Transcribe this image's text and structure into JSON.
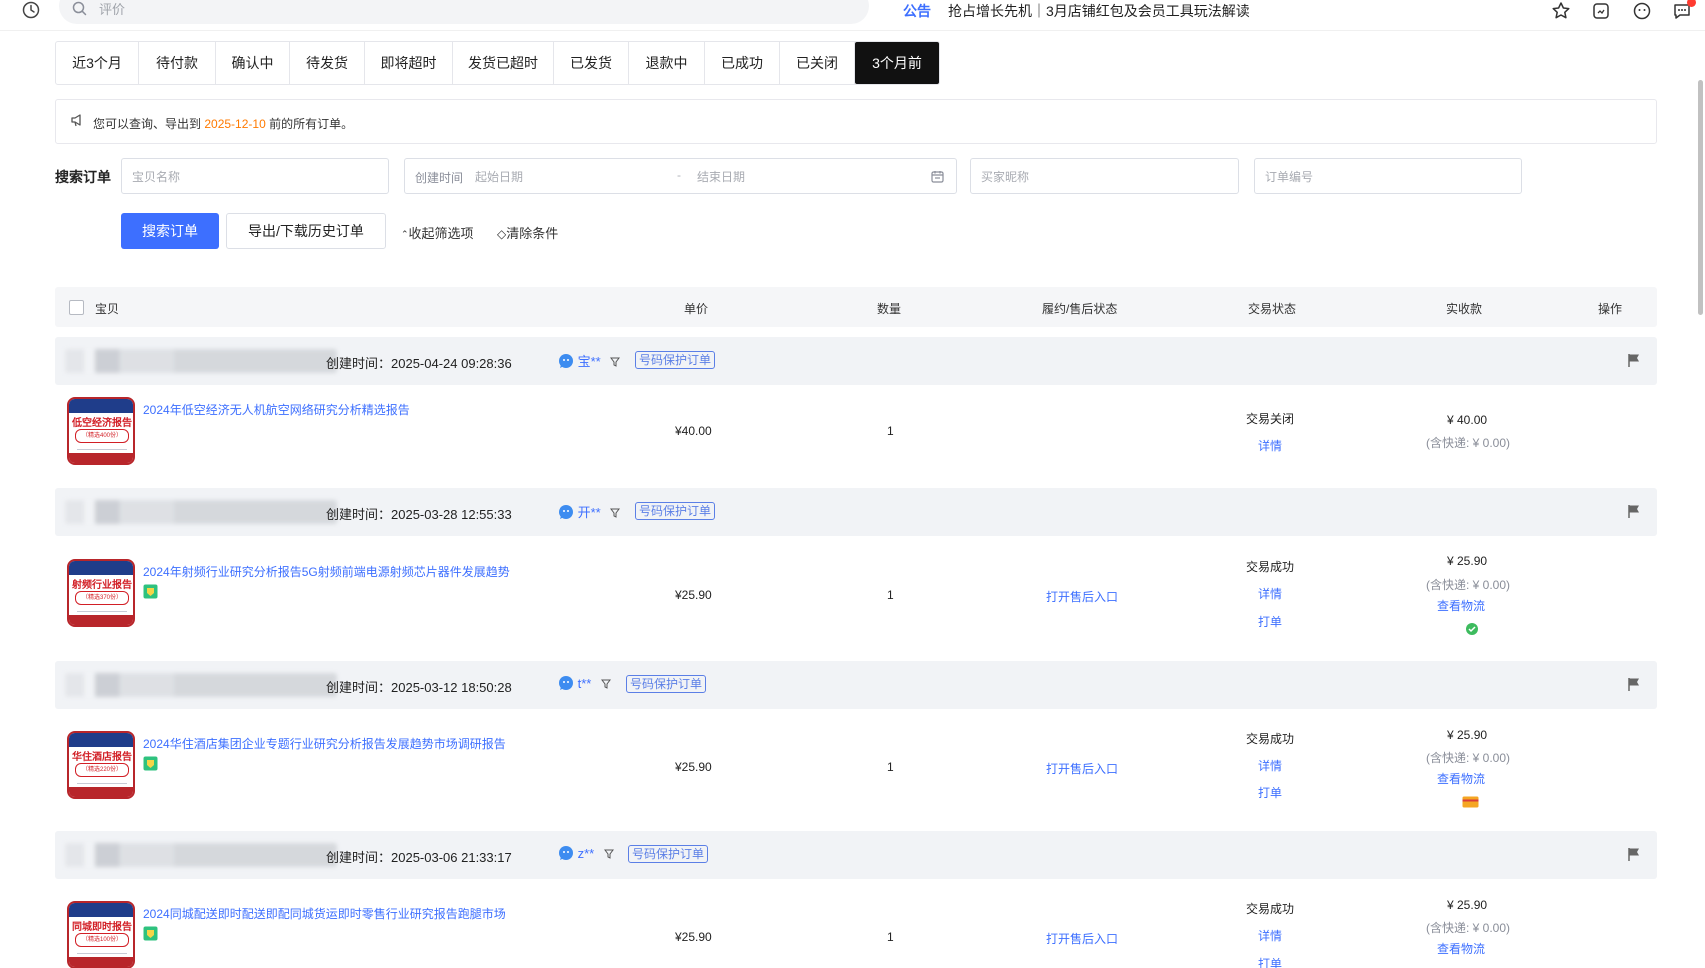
{
  "topbar": {
    "search_placeholder": "评价",
    "notice_label": "公告",
    "notice_text": "抢占增长先机｜3月店铺红包及会员工具玩法解读"
  },
  "tabs": [
    {
      "label": "近3个月",
      "active": false
    },
    {
      "label": "待付款",
      "active": false
    },
    {
      "label": "确认中",
      "active": false
    },
    {
      "label": "待发货",
      "active": false
    },
    {
      "label": "即将超时",
      "active": false
    },
    {
      "label": "发货已超时",
      "active": false
    },
    {
      "label": "已发货",
      "active": false
    },
    {
      "label": "退款中",
      "active": false
    },
    {
      "label": "已成功",
      "active": false
    },
    {
      "label": "已关闭",
      "active": false
    },
    {
      "label": "3个月前",
      "active": true
    }
  ],
  "banner": {
    "prefix": "您可以查询、导出到",
    "date": "2025-12-10",
    "suffix": "前的所有订单。"
  },
  "filters": {
    "title": "搜索订单",
    "product_placeholder": "宝贝名称",
    "date_label": "创建时间",
    "date_start_placeholder": "起始日期",
    "date_separator": "-",
    "date_end_placeholder": "结束日期",
    "buyer_placeholder": "买家昵称",
    "order_no_placeholder": "订单编号",
    "search_button": "搜索订单",
    "export_button": "导出/下载历史订单",
    "collapse_link": "收起筛选项",
    "clear_link": "清除条件"
  },
  "table_header": {
    "product": "宝贝",
    "unit_price": "单价",
    "quantity": "数量",
    "fulfillment": "履约/售后状态",
    "trade_status": "交易状态",
    "received": "实收款",
    "actions": "操作"
  },
  "orders": [
    {
      "created": "创建时间：2025-04-24 09:28:36",
      "buyer": "宝**",
      "protect_tag": "号码保护订单",
      "product_title": "2024年低空经济无人机航空网络研究分析精选报告",
      "thumb_title": "低空经济报告",
      "thumb_sub": "（精选400份）",
      "price": "¥40.00",
      "quantity": "1",
      "aftersale": "",
      "status": "交易关闭",
      "links": [
        "详情"
      ],
      "amount": "¥ 40.00",
      "shipping": "(含快递: ¥ 0.00)",
      "logistics": ""
    },
    {
      "created": "创建时间：2025-03-28 12:55:33",
      "buyer": "开**",
      "protect_tag": "号码保护订单",
      "product_title": "2024年射频行业研究分析报告5G射频前端电源射频芯片器件发展趋势",
      "thumb_title": "射频行业报告",
      "thumb_sub": "（精选370份）",
      "price": "¥25.90",
      "quantity": "1",
      "aftersale": "打开售后入口",
      "status": "交易成功",
      "links": [
        "详情",
        "打单"
      ],
      "amount": "¥ 25.90",
      "shipping": "(含快递: ¥ 0.00)",
      "logistics": "查看物流"
    },
    {
      "created": "创建时间：2025-03-12 18:50:28",
      "buyer": "t**",
      "protect_tag": "号码保护订单",
      "product_title": "2024华住酒店集团企业专题行业研究分析报告发展趋势市场调研报告",
      "thumb_title": "华住酒店报告",
      "thumb_sub": "（精选220份）",
      "price": "¥25.90",
      "quantity": "1",
      "aftersale": "打开售后入口",
      "status": "交易成功",
      "links": [
        "详情",
        "打单"
      ],
      "amount": "¥ 25.90",
      "shipping": "(含快递: ¥ 0.00)",
      "logistics": "查看物流"
    },
    {
      "created": "创建时间：2025-03-06 21:33:17",
      "buyer": "z**",
      "protect_tag": "号码保护订单",
      "product_title": "2024同城配送即时配送即配同城货运即时零售行业研究报告跑腿市场",
      "thumb_title": "同城即时报告",
      "thumb_sub": "（精选100份）",
      "price": "¥25.90",
      "quantity": "1",
      "aftersale": "打开售后入口",
      "status": "交易成功",
      "links": [
        "详情",
        "打单"
      ],
      "amount": "¥ 25.90",
      "shipping": "(含快递: ¥ 0.00)",
      "logistics": "查看物流"
    }
  ]
}
